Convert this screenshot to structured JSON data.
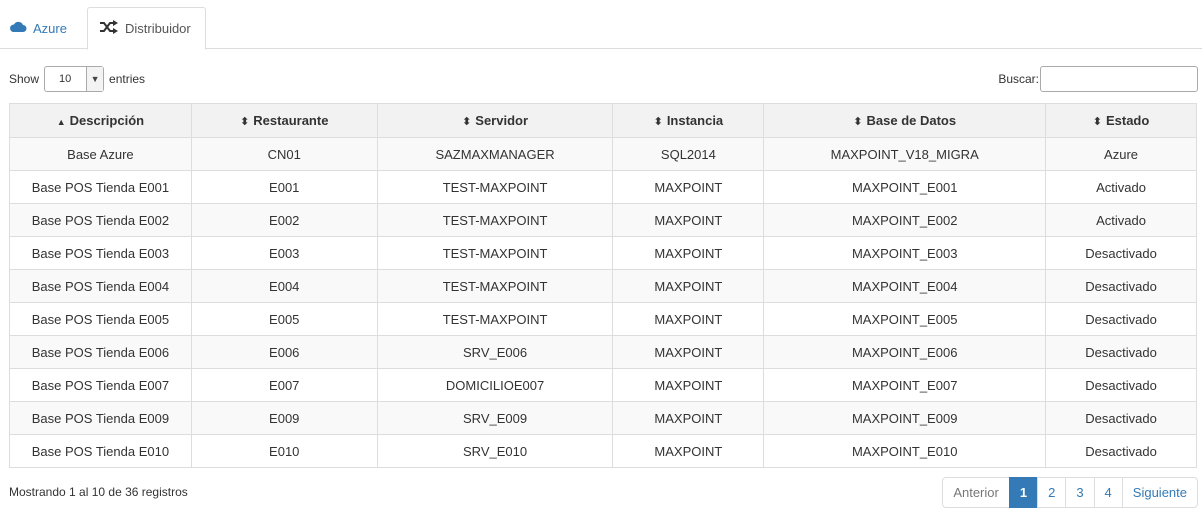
{
  "tabs": [
    {
      "label": "Azure",
      "icon": "cloud-icon"
    },
    {
      "label": "Distribuidor",
      "icon": "shuffle-icon"
    }
  ],
  "controls": {
    "show_label": "Show",
    "page_size": "10",
    "entries_label": "entries",
    "search_label": "Buscar:",
    "search_value": ""
  },
  "table": {
    "columns": [
      "Descripción",
      "Restaurante",
      "Servidor",
      "Instancia",
      "Base de Datos",
      "Estado"
    ],
    "rows": [
      [
        "Base Azure",
        "CN01",
        "SAZMAXMANAGER",
        "SQL2014",
        "MAXPOINT_V18_MIGRA",
        "Azure"
      ],
      [
        "Base POS Tienda E001",
        "E001",
        "TEST-MAXPOINT",
        "MAXPOINT",
        "MAXPOINT_E001",
        "Activado"
      ],
      [
        "Base POS Tienda E002",
        "E002",
        "TEST-MAXPOINT",
        "MAXPOINT",
        "MAXPOINT_E002",
        "Activado"
      ],
      [
        "Base POS Tienda E003",
        "E003",
        "TEST-MAXPOINT",
        "MAXPOINT",
        "MAXPOINT_E003",
        "Desactivado"
      ],
      [
        "Base POS Tienda E004",
        "E004",
        "TEST-MAXPOINT",
        "MAXPOINT",
        "MAXPOINT_E004",
        "Desactivado"
      ],
      [
        "Base POS Tienda E005",
        "E005",
        "TEST-MAXPOINT",
        "MAXPOINT",
        "MAXPOINT_E005",
        "Desactivado"
      ],
      [
        "Base POS Tienda E006",
        "E006",
        "SRV_E006",
        "MAXPOINT",
        "MAXPOINT_E006",
        "Desactivado"
      ],
      [
        "Base POS Tienda E007",
        "E007",
        "DOMICILIOE007",
        "MAXPOINT",
        "MAXPOINT_E007",
        "Desactivado"
      ],
      [
        "Base POS Tienda E009",
        "E009",
        "SRV_E009",
        "MAXPOINT",
        "MAXPOINT_E009",
        "Desactivado"
      ],
      [
        "Base POS Tienda E010",
        "E010",
        "SRV_E010",
        "MAXPOINT",
        "MAXPOINT_E010",
        "Desactivado"
      ]
    ]
  },
  "footer": {
    "info": "Mostrando 1 al 10 de 36 registros",
    "pagination": [
      "Anterior",
      "1",
      "2",
      "3",
      "4",
      "Siguiente"
    ],
    "active_page": "1"
  },
  "colors": {
    "accent": "#337ab7"
  }
}
